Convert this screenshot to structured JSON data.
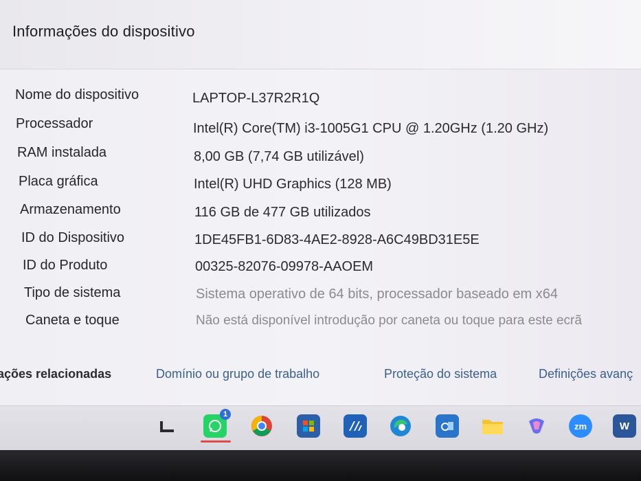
{
  "title": "Informações do dispositivo",
  "specs": [
    {
      "label": "Nome do dispositivo",
      "value": "LAPTOP-L37R2R1Q"
    },
    {
      "label": "Processador",
      "value": "Intel(R) Core(TM) i3-1005G1 CPU @ 1.20GHz (1.20 GHz)"
    },
    {
      "label": "RAM instalada",
      "value": "8,00 GB (7,74 GB utilizável)"
    },
    {
      "label": "Placa gráfica",
      "value": "Intel(R) UHD Graphics (128 MB)"
    },
    {
      "label": "Armazenamento",
      "value": "116 GB de 477 GB utilizados"
    },
    {
      "label": "ID do Dispositivo",
      "value": "1DE45FB1-6D83-4AE2-8928-A6C49BD31E5E"
    },
    {
      "label": "ID do Produto",
      "value": "00325-82076-09978-AAOEM"
    },
    {
      "label": "Tipo de sistema",
      "value": "Sistema operativo de 64 bits, processador baseado em x64"
    },
    {
      "label": "Caneta e toque",
      "value": "Não está disponível introdução por caneta ou toque para este ecrã"
    }
  ],
  "related": {
    "heading": "ações relacionadas",
    "links": [
      "Domínio ou grupo de trabalho",
      "Proteção do sistema",
      "Definições avanç"
    ]
  },
  "taskbar": {
    "whatsapp_badge": "1",
    "zoom_label": "zm",
    "word_label": "W"
  },
  "colors": {
    "link": "#3a5f8f",
    "whatsapp": "#25d366",
    "active_indicator": "#e24a4a"
  }
}
